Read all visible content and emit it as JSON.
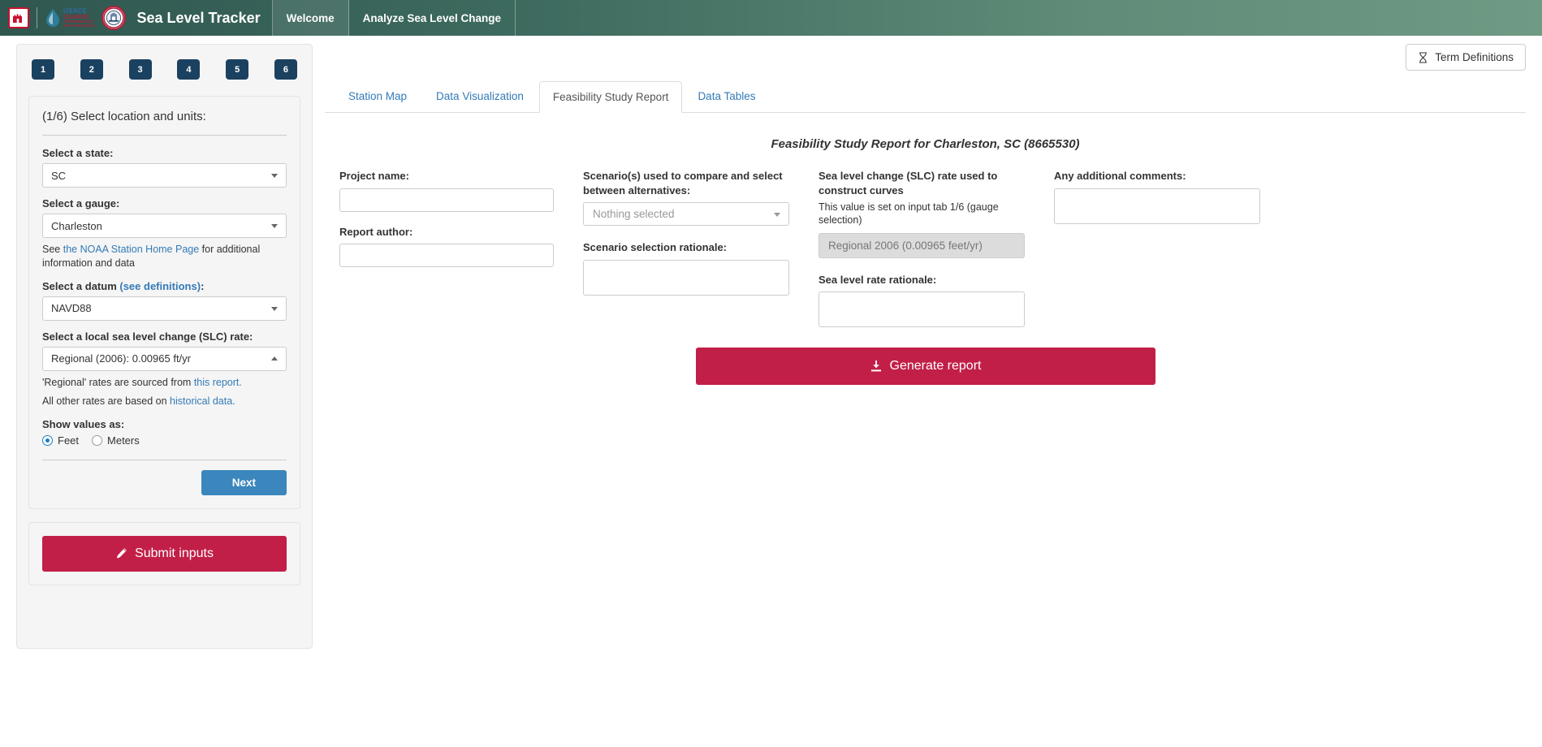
{
  "navbar": {
    "brand_title": "Sea Level Tracker",
    "items": [
      {
        "label": "Welcome",
        "active": true
      },
      {
        "label": "Analyze Sea Level Change",
        "active": false
      }
    ],
    "logos": {
      "castle": "usace-castle-icon",
      "usace_climate_line1": "USACE",
      "usace_climate_line2": "CLIMATE",
      "usace_climate_line3": "PREPAREDNESS",
      "usace_climate_line4": "AND RESILIENCE",
      "seal": "agency-seal-icon"
    }
  },
  "sidebar": {
    "steps": [
      "1",
      "2",
      "3",
      "4",
      "5",
      "6"
    ],
    "panel_title": "(1/6) Select location and units:",
    "state": {
      "label": "Select a state:",
      "value": "SC"
    },
    "gauge": {
      "label": "Select a gauge:",
      "value": "Charleston"
    },
    "gauge_helper": {
      "prefix": "See ",
      "link": "the NOAA Station Home Page",
      "suffix": " for additional information and data"
    },
    "datum": {
      "label_main": "Select a datum ",
      "label_link": "(see definitions)",
      "label_colon": ":",
      "value": "NAVD88"
    },
    "slc_rate": {
      "label": "Select a local sea level change (SLC) rate:",
      "value": "Regional (2006): 0.00965 ft/yr"
    },
    "rate_note_1": {
      "prefix": "'Regional' rates are sourced from ",
      "link": "this report."
    },
    "rate_note_2": {
      "prefix": "All other rates are based on ",
      "link": "historical data."
    },
    "units": {
      "label": "Show values as:",
      "options": [
        {
          "label": "Feet",
          "selected": true
        },
        {
          "label": "Meters",
          "selected": false
        }
      ]
    },
    "next_label": "Next",
    "submit_label": "Submit inputs",
    "submit_icon": "pencil-icon"
  },
  "main": {
    "term_definitions": {
      "label": "Term Definitions",
      "icon": "hourglass-icon"
    },
    "tabs": [
      {
        "label": "Station Map",
        "active": false
      },
      {
        "label": "Data Visualization",
        "active": false
      },
      {
        "label": "Feasibility Study Report",
        "active": true
      },
      {
        "label": "Data Tables",
        "active": false
      }
    ],
    "report_title": "Feasibility Study Report for Charleston, SC (8665530)",
    "fields": {
      "project_name": {
        "label": "Project name:",
        "value": ""
      },
      "report_author": {
        "label": "Report author:",
        "value": ""
      },
      "scenarios": {
        "label": "Scenario(s) used to compare and select between alternatives:",
        "value": "Nothing selected"
      },
      "scenario_rationale": {
        "label": "Scenario selection rationale:",
        "value": ""
      },
      "slc_rate_used": {
        "label": "Sea level change (SLC) rate used to construct curves",
        "note": "This value is set on input tab 1/6 (gauge selection)",
        "value": "Regional 2006 (0.00965 feet/yr)"
      },
      "sea_level_rate_rationale": {
        "label": "Sea level rate rationale:",
        "value": ""
      },
      "additional_comments": {
        "label": "Any additional comments:",
        "value": ""
      }
    },
    "generate_button": {
      "label": "Generate report",
      "icon": "download-icon"
    }
  },
  "colors": {
    "navbar_green": "#3e6b5f",
    "step_navy": "#1b4160",
    "accent_crimson": "#c21f48",
    "link_blue": "#337ab7",
    "next_blue": "#3a86bd"
  }
}
